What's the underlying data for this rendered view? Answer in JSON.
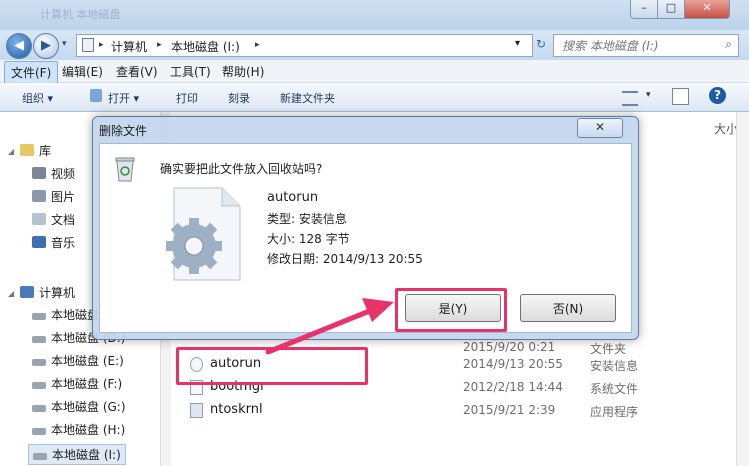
{
  "window": {
    "ghost_title": "计算机 本地磁盘",
    "min_glyph": "–",
    "max_glyph": "□",
    "close_glyph": "✕"
  },
  "address": {
    "back_glyph": "◀",
    "forward_glyph": "▶",
    "path": [
      "计算机",
      "本地磁盘 (I:)"
    ],
    "separator": "▸",
    "dropdown_glyph": "▾",
    "refresh_glyph": "↻",
    "search_placeholder": "搜索 本地磁盘 (I:)",
    "search_glyph": "⌕"
  },
  "menu": [
    {
      "label": "文件(F)"
    },
    {
      "label": "编辑(E)"
    },
    {
      "label": "查看(V)"
    },
    {
      "label": "工具(T)"
    },
    {
      "label": "帮助(H)"
    }
  ],
  "toolbar": {
    "organize": "组织 ▾",
    "open": "打开 ▾",
    "print": "打印",
    "burn": "刻录",
    "new_folder": "新建文件夹",
    "help_glyph": "?"
  },
  "nav": {
    "library": "库",
    "libraries": [
      "视频",
      "图片",
      "文档",
      "音乐"
    ],
    "computer": "计算机",
    "drives": [
      "本地磁盘",
      "本地磁盘 (D:)",
      "本地磁盘 (E:)",
      "本地磁盘 (F:)",
      "本地磁盘 (G:)",
      "本地磁盘 (H:)",
      "本地磁盘 (I:)"
    ]
  },
  "files": {
    "size_header": "大小",
    "rows": [
      {
        "name": "autorun",
        "date": "2014/9/13 20:55",
        "type": "安装信息"
      },
      {
        "name": "bootmgr",
        "date": "2012/2/18 14:44",
        "type": "系统文件"
      },
      {
        "name": "ntoskrnl",
        "date": "2015/9/21 2:39",
        "type": "应用程序"
      }
    ],
    "partial_row": {
      "date": "2015/9/20 0:21",
      "type": "文件夹"
    }
  },
  "dialog": {
    "title": "删除文件",
    "close_glyph": "✕",
    "question": "确实要把此文件放入回收站吗?",
    "file_name": "autorun",
    "file_type": "类型: 安装信息",
    "file_size": "大小: 128 字节",
    "file_modified": "修改日期: 2014/9/13 20:55",
    "yes_label": "是(Y)",
    "no_label": "否(N)"
  },
  "colors": {
    "highlight": "#e8326a",
    "window_frame": "#c6d9ee"
  }
}
